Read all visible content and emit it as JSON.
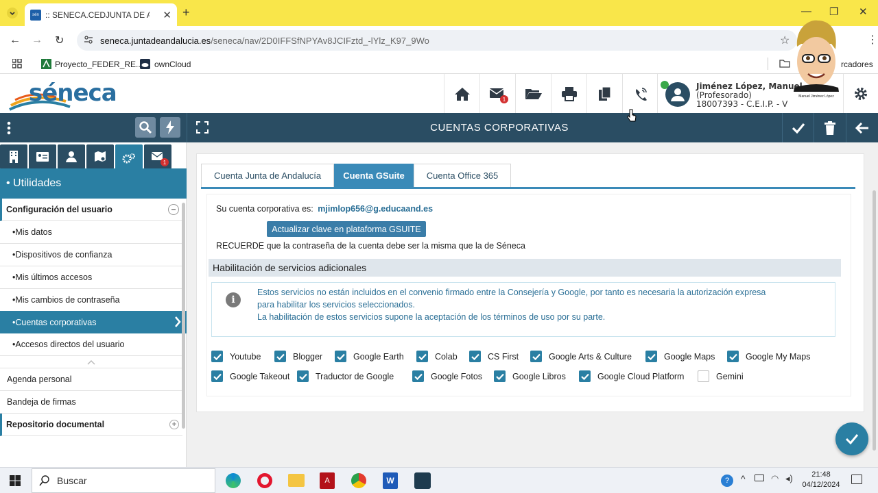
{
  "browser": {
    "tab_title": ":: SENECA.CEDJUNTA DE ANDALUCIA",
    "tab_favicon": "sén",
    "url_domain": "seneca.juntadeandalucia.es",
    "url_path": "/seneca/nav/2D0IFFSfNPYAv8JCIFztd_-lYlz_K97_9Wo",
    "bookmarks": [
      {
        "label": "Proyecto_FEDER_RE..."
      },
      {
        "label": "ownCloud"
      }
    ],
    "bookmarks_right": "rcadores"
  },
  "app": {
    "logo_text": "séneca",
    "header_badge": "1",
    "user_name": "Jiménez López, Manuel",
    "user_role": "(Profesorado)",
    "user_center": "18007393 - C.E.I.P. - V",
    "page_title": "CUENTAS CORPORATIVAS",
    "avatar_caption": "Manuel Jiménez López"
  },
  "sidebar": {
    "tab_badge": "1",
    "section_title": "• Utilidades",
    "group_title": "Configuración del usuario",
    "items": [
      {
        "label": "•Mis datos"
      },
      {
        "label": "•Dispositivos de confianza"
      },
      {
        "label": "•Mis últimos accesos"
      },
      {
        "label": "•Mis cambios de contraseña"
      },
      {
        "label": "•Cuentas corporativas"
      },
      {
        "label": "•Accesos directos del usuario"
      }
    ],
    "other_items": [
      {
        "label": "Agenda personal"
      },
      {
        "label": "Bandeja de firmas"
      }
    ],
    "repo_title": "Repositorio documental"
  },
  "main": {
    "tabs": [
      {
        "label": "Cuenta Junta de Andalucía"
      },
      {
        "label": "Cuenta GSuite"
      },
      {
        "label": "Cuenta Office 365"
      }
    ],
    "account_label": "Su cuenta corporativa es:",
    "account_email": "mjimlop656@g.educaand.es",
    "update_button": "Actualizar clave en plataforma GSUITE",
    "reminder": "RECUERDE que la contraseña de la cuenta debe ser la misma que la de Séneca",
    "section_header": "Habilitación de servicios adicionales",
    "info_line1": "Estos servicios no están incluidos en el convenio firmado entre la Consejería y Google, por tanto es necesaria la autorización expresa",
    "info_line2": "para habilitar los servicios seleccionados.",
    "info_line3": "La habilitación de estos servicios supone la aceptación de los términos de uso por su parte.",
    "services": [
      {
        "label": "Youtube",
        "checked": true
      },
      {
        "label": "Blogger",
        "checked": true
      },
      {
        "label": "Google Earth",
        "checked": true
      },
      {
        "label": "Colab",
        "checked": true
      },
      {
        "label": "CS First",
        "checked": true
      },
      {
        "label": "Google Arts & Culture",
        "checked": true
      },
      {
        "label": "Google Maps",
        "checked": true
      },
      {
        "label": "Google My Maps",
        "checked": true
      },
      {
        "label": "Google Takeout",
        "checked": true
      },
      {
        "label": "Traductor de Google",
        "checked": true
      },
      {
        "label": "Google Fotos",
        "checked": true
      },
      {
        "label": "Google Libros",
        "checked": true
      },
      {
        "label": "Google Cloud Platform",
        "checked": true
      },
      {
        "label": "Gemini",
        "checked": false
      }
    ]
  },
  "taskbar": {
    "search_placeholder": "Buscar",
    "time": "21:48",
    "date": "04/12/2024"
  },
  "colors": {
    "dark_bar": "#2a4d63",
    "accent": "#2a7fa3",
    "tab_bar": "#f9e64a"
  }
}
